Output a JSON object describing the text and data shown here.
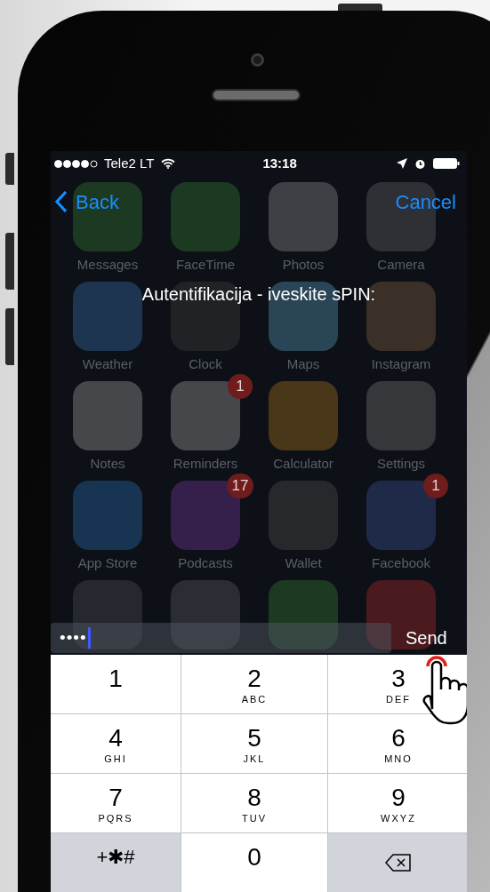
{
  "status_bar": {
    "carrier": "Tele2 LT",
    "time": "13:18"
  },
  "nav": {
    "back": "Back",
    "cancel": "Cancel"
  },
  "prompt": "Autentifikacija - iveskite sPIN:",
  "home_apps": [
    {
      "label": "Messages",
      "color": "#1c3a22"
    },
    {
      "label": "FaceTime",
      "color": "#1c3a22"
    },
    {
      "label": "Photos",
      "color": "#3e4045"
    },
    {
      "label": "Camera",
      "color": "#2e3035"
    },
    {
      "label": "Weather",
      "color": "#1d3550"
    },
    {
      "label": "Clock",
      "color": "#202226"
    },
    {
      "label": "Maps",
      "color": "#2a4555"
    },
    {
      "label": "Instagram",
      "color": "#3a3028"
    },
    {
      "label": "Notes",
      "color": "#45474a"
    },
    {
      "label": "Reminders",
      "color": "#45474a",
      "badge": "1"
    },
    {
      "label": "Calculator",
      "color": "#4a3618"
    },
    {
      "label": "Settings",
      "color": "#35373b"
    },
    {
      "label": "App Store",
      "color": "#173552"
    },
    {
      "label": "Podcasts",
      "color": "#34204a",
      "badge": "17"
    },
    {
      "label": "Wallet",
      "color": "#26282c"
    },
    {
      "label": "Facebook",
      "color": "#1e2a48",
      "badge": "1"
    },
    {
      "color": "#25282e"
    },
    {
      "color": "#2a2d33"
    },
    {
      "color": "#1c3a22"
    },
    {
      "color": "#4a1a1e"
    }
  ],
  "pin_field": {
    "value": "••••"
  },
  "send": "Send",
  "keypad": [
    {
      "kind": "digit",
      "digit": "1"
    },
    {
      "kind": "digit",
      "digit": "2",
      "letters": "ABC"
    },
    {
      "kind": "digit",
      "digit": "3",
      "letters": "DEF"
    },
    {
      "kind": "digit",
      "digit": "4",
      "letters": "GHI"
    },
    {
      "kind": "digit",
      "digit": "5",
      "letters": "JKL"
    },
    {
      "kind": "digit",
      "digit": "6",
      "letters": "MNO"
    },
    {
      "kind": "digit",
      "digit": "7",
      "letters": "PQRS"
    },
    {
      "kind": "digit",
      "digit": "8",
      "letters": "TUV"
    },
    {
      "kind": "digit",
      "digit": "9",
      "letters": "WXYZ"
    },
    {
      "kind": "symbol",
      "digit": "+✱#"
    },
    {
      "kind": "digit",
      "digit": "0"
    },
    {
      "kind": "delete"
    }
  ]
}
